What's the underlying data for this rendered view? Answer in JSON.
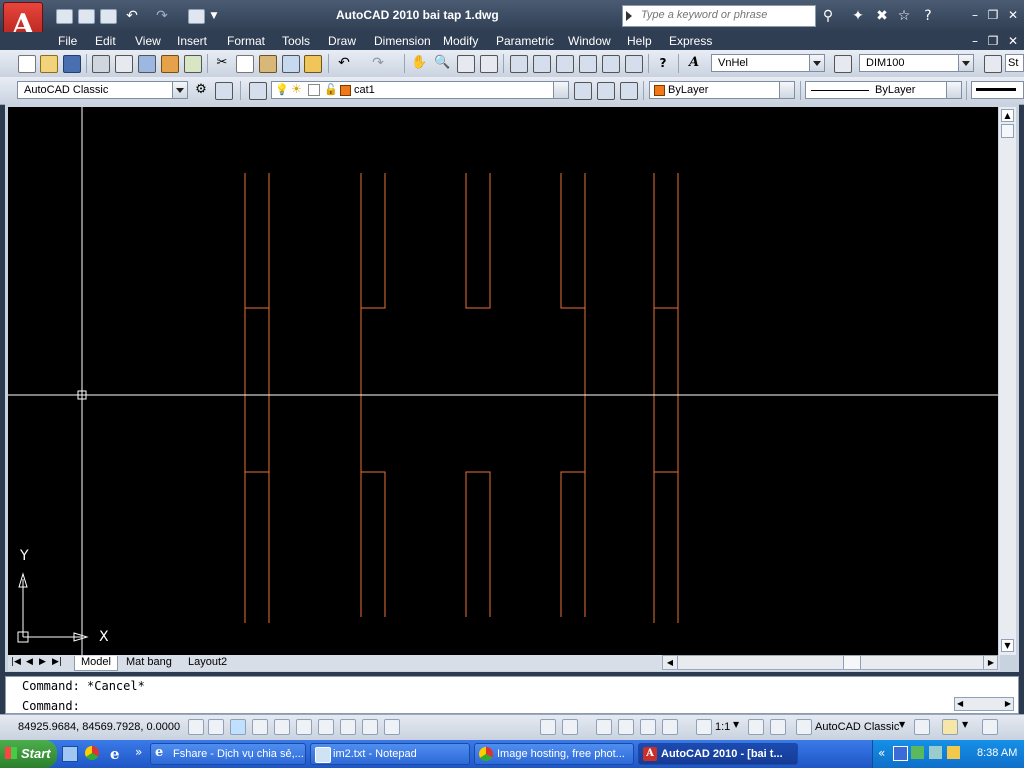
{
  "window": {
    "title": "AutoCAD 2010     bai tap 1.dwg",
    "app_logo": "A",
    "search_placeholder": "Type a keyword or phrase"
  },
  "menu": [
    "File",
    "Edit",
    "View",
    "Insert",
    "Format",
    "Tools",
    "Draw",
    "Dimension",
    "Modify",
    "Parametric",
    "Window",
    "Help",
    "Express"
  ],
  "toolbar": {
    "text_style": "VnHel",
    "dim_style": "DIM100",
    "dim_style_partial": "St",
    "workspace": "AutoCAD Classic",
    "layer": "cat1",
    "color": "ByLayer",
    "linetype": "ByLayer"
  },
  "colors": {
    "drawing_background": "#000000",
    "geometry_orange": "#e8703a",
    "crosshair": "#ffffff",
    "layer_swatch": "#f07818"
  },
  "ucs": {
    "x_label": "X",
    "y_label": "Y"
  },
  "layout_tabs": [
    "Model",
    "Mat bang",
    "Layout2"
  ],
  "command": {
    "history": "Command:  *Cancel*",
    "prompt": "Command:"
  },
  "status": {
    "coordinates": "84925.9684, 84569.7928, 0.0000",
    "annotation_scale": "1:1",
    "workspace": "AutoCAD Classic"
  },
  "taskbar": {
    "start": "Start",
    "tasks": [
      {
        "label": "Fshare - Dịch vụ chia sẻ,...",
        "icon": "ie-icon"
      },
      {
        "label": "im2.txt - Notepad",
        "icon": "notepad-icon"
      },
      {
        "label": "Image hosting, free phot...",
        "icon": "chrome-icon"
      },
      {
        "label": "AutoCAD 2010 - [bai t...",
        "icon": "autocad-icon"
      }
    ],
    "clock": "8:38 AM"
  }
}
